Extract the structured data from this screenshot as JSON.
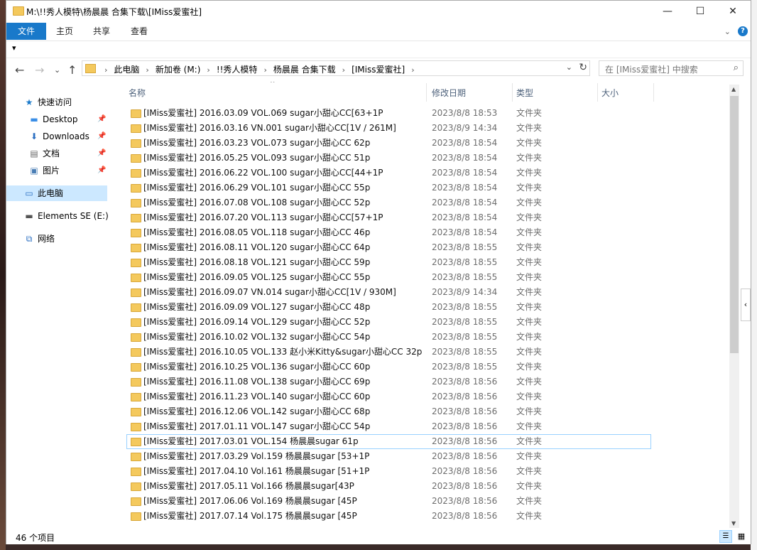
{
  "window": {
    "title": "M:\\!!秀人模特\\杨晨晨 合集下载\\[IMiss爱蜜社]",
    "minimize": "—",
    "maximize": "☐",
    "close": "✕"
  },
  "ribbon": {
    "tabs": [
      "文件",
      "主页",
      "共享",
      "查看"
    ],
    "help": "?",
    "expand": "⌄"
  },
  "qat": {
    "customize": "▾"
  },
  "nav": {
    "back": "←",
    "forward": "→",
    "recent": "⌄",
    "up": "↑",
    "breadcrumbs": [
      "此电脑",
      "新加卷 (M:)",
      "!!秀人模特",
      "杨晨晨 合集下载",
      "[IMiss爱蜜社]"
    ],
    "breadcrumb_sep": "›",
    "dropdown": "⌄",
    "refresh": "↻",
    "search_placeholder": "在 [IMiss爱蜜社] 中搜索",
    "search_icon": "⌕"
  },
  "sidebar": {
    "items": [
      {
        "label": "快速访问",
        "icon": "star-icon",
        "glyph": "★",
        "color": "#1979ca",
        "pinned": false
      },
      {
        "label": "Desktop",
        "icon": "desktop-icon",
        "glyph": "▬",
        "color": "#3a8ee6",
        "pinned": true
      },
      {
        "label": "Downloads",
        "icon": "download-icon",
        "glyph": "⬇",
        "color": "#2b6fc2",
        "pinned": true
      },
      {
        "label": "文档",
        "icon": "document-icon",
        "glyph": "▤",
        "color": "#666",
        "pinned": true
      },
      {
        "label": "图片",
        "icon": "picture-icon",
        "glyph": "▣",
        "color": "#4a7eb5",
        "pinned": true
      },
      {
        "label": "此电脑",
        "icon": "computer-icon",
        "glyph": "▭",
        "color": "#2b6fc2",
        "pinned": false
      },
      {
        "label": "Elements SE (E:)",
        "icon": "drive-icon",
        "glyph": "▬",
        "color": "#555",
        "pinned": false
      },
      {
        "label": "网络",
        "icon": "network-icon",
        "glyph": "⧉",
        "color": "#2b6fc2",
        "pinned": false
      }
    ],
    "pin_glyph": "📌"
  },
  "columns": {
    "name": "名称",
    "date": "修改日期",
    "type": "类型",
    "size": "大小",
    "sort_indicator": "^"
  },
  "files": [
    {
      "name": "[IMiss爱蜜社] 2016.03.09 VOL.069 sugar小甜心CC[63+1P",
      "date": "2023/8/8 18:53",
      "type": "文件夹"
    },
    {
      "name": "[IMiss爱蜜社] 2016.03.16 VN.001 sugar小甜心CC[1V / 261M]",
      "date": "2023/8/9 14:34",
      "type": "文件夹"
    },
    {
      "name": "[IMiss爱蜜社] 2016.03.23 VOL.073 sugar小甜心CC 62p",
      "date": "2023/8/8 18:54",
      "type": "文件夹"
    },
    {
      "name": "[IMiss爱蜜社] 2016.05.25 VOL.093 sugar小甜心CC 51p",
      "date": "2023/8/8 18:54",
      "type": "文件夹"
    },
    {
      "name": "[IMiss爱蜜社] 2016.06.22 VOL.100 sugar小甜心CC[44+1P",
      "date": "2023/8/8 18:54",
      "type": "文件夹"
    },
    {
      "name": "[IMiss爱蜜社] 2016.06.29 VOL.101 sugar小甜心CC 55p",
      "date": "2023/8/8 18:54",
      "type": "文件夹"
    },
    {
      "name": "[IMiss爱蜜社] 2016.07.08 VOL.108 sugar小甜心CC 52p",
      "date": "2023/8/8 18:54",
      "type": "文件夹"
    },
    {
      "name": "[IMiss爱蜜社] 2016.07.20 VOL.113 sugar小甜心CC[57+1P",
      "date": "2023/8/8 18:54",
      "type": "文件夹"
    },
    {
      "name": "[IMiss爱蜜社] 2016.08.05 VOL.118 sugar小甜心CC 46p",
      "date": "2023/8/8 18:54",
      "type": "文件夹"
    },
    {
      "name": "[IMiss爱蜜社] 2016.08.11 VOL.120 sugar小甜心CC 64p",
      "date": "2023/8/8 18:55",
      "type": "文件夹"
    },
    {
      "name": "[IMiss爱蜜社] 2016.08.18 VOL.121 sugar小甜心CC 59p",
      "date": "2023/8/8 18:55",
      "type": "文件夹"
    },
    {
      "name": "[IMiss爱蜜社] 2016.09.05 VOL.125 sugar小甜心CC 55p",
      "date": "2023/8/8 18:55",
      "type": "文件夹"
    },
    {
      "name": "[IMiss爱蜜社] 2016.09.07 VN.014 sugar小甜心CC[1V / 930M]",
      "date": "2023/8/9 14:34",
      "type": "文件夹"
    },
    {
      "name": "[IMiss爱蜜社] 2016.09.09 VOL.127 sugar小甜心CC 48p",
      "date": "2023/8/8 18:55",
      "type": "文件夹"
    },
    {
      "name": "[IMiss爱蜜社] 2016.09.14 VOL.129 sugar小甜心CC 52p",
      "date": "2023/8/8 18:55",
      "type": "文件夹"
    },
    {
      "name": "[IMiss爱蜜社] 2016.10.02 VOL.132 sugar小甜心CC 54p",
      "date": "2023/8/8 18:55",
      "type": "文件夹"
    },
    {
      "name": "[IMiss爱蜜社] 2016.10.05 VOL.133 赵小米Kitty&sugar小甜心CC 32p",
      "date": "2023/8/8 18:55",
      "type": "文件夹"
    },
    {
      "name": "[IMiss爱蜜社] 2016.10.25 VOL.136 sugar小甜心CC 60p",
      "date": "2023/8/8 18:55",
      "type": "文件夹"
    },
    {
      "name": "[IMiss爱蜜社] 2016.11.08 VOL.138 sugar小甜心CC 69p",
      "date": "2023/8/8 18:56",
      "type": "文件夹"
    },
    {
      "name": "[IMiss爱蜜社] 2016.11.23 VOL.140 sugar小甜心CC 60p",
      "date": "2023/8/8 18:56",
      "type": "文件夹"
    },
    {
      "name": "[IMiss爱蜜社] 2016.12.06 VOL.142 sugar小甜心CC 68p",
      "date": "2023/8/8 18:56",
      "type": "文件夹"
    },
    {
      "name": "[IMiss爱蜜社] 2017.01.11 VOL.147 sugar小甜心CC 54p",
      "date": "2023/8/8 18:56",
      "type": "文件夹"
    },
    {
      "name": "[IMiss爱蜜社] 2017.03.01 VOL.154 杨晨晨sugar 61p",
      "date": "2023/8/8 18:56",
      "type": "文件夹",
      "highlight": true
    },
    {
      "name": "[IMiss爱蜜社] 2017.03.29 Vol.159 杨晨晨sugar [53+1P",
      "date": "2023/8/8 18:56",
      "type": "文件夹"
    },
    {
      "name": "[IMiss爱蜜社] 2017.04.10 Vol.161 杨晨晨sugar [51+1P",
      "date": "2023/8/8 18:56",
      "type": "文件夹"
    },
    {
      "name": "[IMiss爱蜜社] 2017.05.11 Vol.166 杨晨晨sugar[43P",
      "date": "2023/8/8 18:56",
      "type": "文件夹"
    },
    {
      "name": "[IMiss爱蜜社] 2017.06.06 Vol.169 杨晨晨sugar [45P",
      "date": "2023/8/8 18:56",
      "type": "文件夹"
    },
    {
      "name": "[IMiss爱蜜社] 2017.07.14 Vol.175 杨晨晨sugar [45P",
      "date": "2023/8/8 18:56",
      "type": "文件夹"
    }
  ],
  "status": {
    "count": "46 个项目",
    "view_details": "☰",
    "view_tiles": "▦"
  },
  "scrollbar": {
    "up": "▲",
    "down": "▼",
    "collapse": "‹"
  }
}
